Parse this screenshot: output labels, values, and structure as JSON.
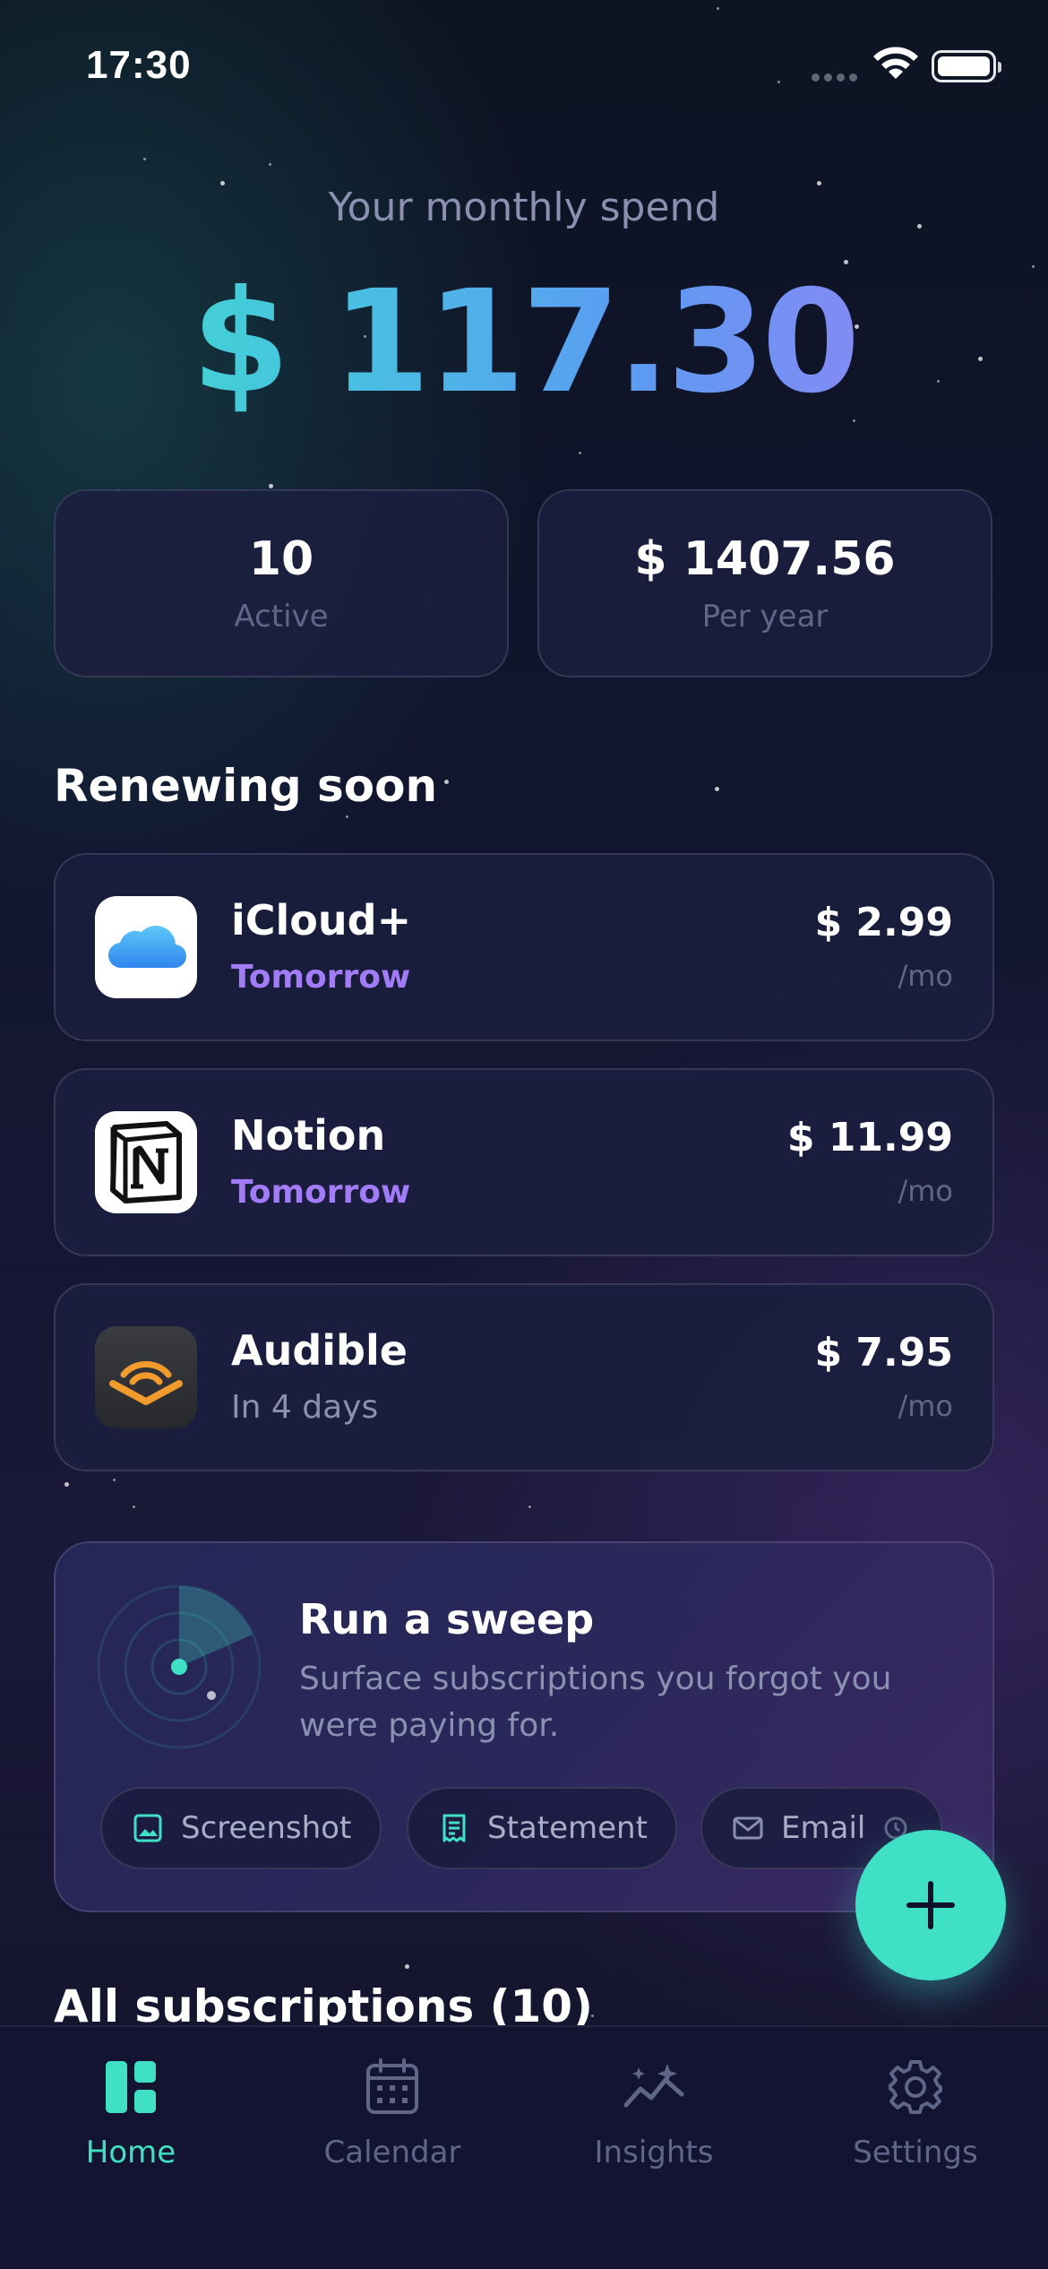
{
  "status_bar": {
    "time": "17:30"
  },
  "hero": {
    "label": "Your monthly spend",
    "amount": "$ 117.30"
  },
  "stats": [
    {
      "value": "10",
      "label": "Active"
    },
    {
      "value": "$ 1407.56",
      "label": "Per year"
    }
  ],
  "renewing": {
    "title": "Renewing soon",
    "items": [
      {
        "name": "iCloud+",
        "when": "Tomorrow",
        "price": "$ 2.99",
        "period": "/mo",
        "icon": "icloud-logo"
      },
      {
        "name": "Notion",
        "when": "Tomorrow",
        "price": "$ 11.99",
        "period": "/mo",
        "icon": "notion-logo"
      },
      {
        "name": "Audible",
        "when": "In 4 days",
        "price": "$ 7.95",
        "period": "/mo",
        "icon": "audible-logo"
      }
    ]
  },
  "sweep": {
    "title": "Run a sweep",
    "description": "Surface subscriptions you forgot you were paying for.",
    "chips": [
      {
        "label": "Screenshot",
        "icon": "image-icon"
      },
      {
        "label": "Statement",
        "icon": "receipt-icon"
      },
      {
        "label": "Email",
        "icon": "mail-icon"
      }
    ]
  },
  "all_subscriptions": {
    "title": "All subscriptions (10)"
  },
  "tabs": [
    {
      "label": "Home",
      "icon": "dashboard-icon",
      "active": true
    },
    {
      "label": "Calendar",
      "icon": "calendar-icon",
      "active": false
    },
    {
      "label": "Insights",
      "icon": "trend-sparkle-icon",
      "active": false
    },
    {
      "label": "Settings",
      "icon": "gear-icon",
      "active": false
    }
  ],
  "colors": {
    "accent_teal": "#3fe0c5",
    "accent_purple": "#a27cf6",
    "background": "#0f1128",
    "card": "#1b1e3e"
  }
}
